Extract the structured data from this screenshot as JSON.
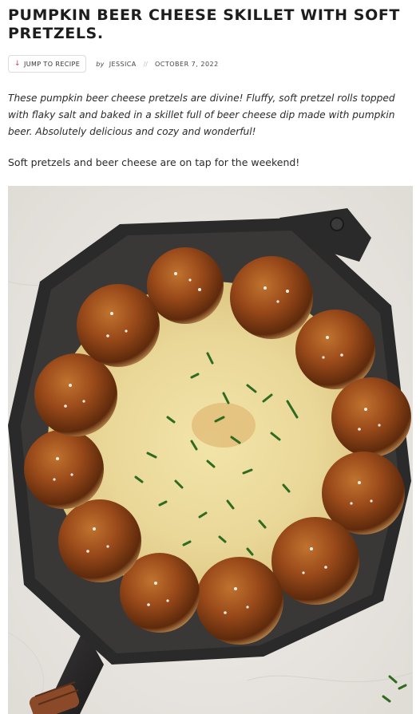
{
  "post": {
    "title": "PUMPKIN BEER CHEESE SKILLET WITH SOFT PRETZELS.",
    "jump_label": "JUMP TO RECIPE",
    "by_label": "by",
    "author": "JESSICA",
    "separator": "//",
    "date": "OCTOBER 7, 2022",
    "intro": "These pumpkin beer cheese pretzels are divine! Fluffy, soft pretzel rolls topped with flaky salt and baked in a skillet full of beer cheese dip made with pumpkin beer. Absolutely delicious and cozy and wonderful!",
    "paragraph": "Soft pretzels and beer cheese are on tap for the weekend!"
  },
  "colors": {
    "accent": "#c2465d",
    "pretzel": "#9a4a1a",
    "cheese": "#eadba5",
    "skillet": "#2b2a2a"
  },
  "icons": {
    "jump": "arrow-down-icon"
  }
}
